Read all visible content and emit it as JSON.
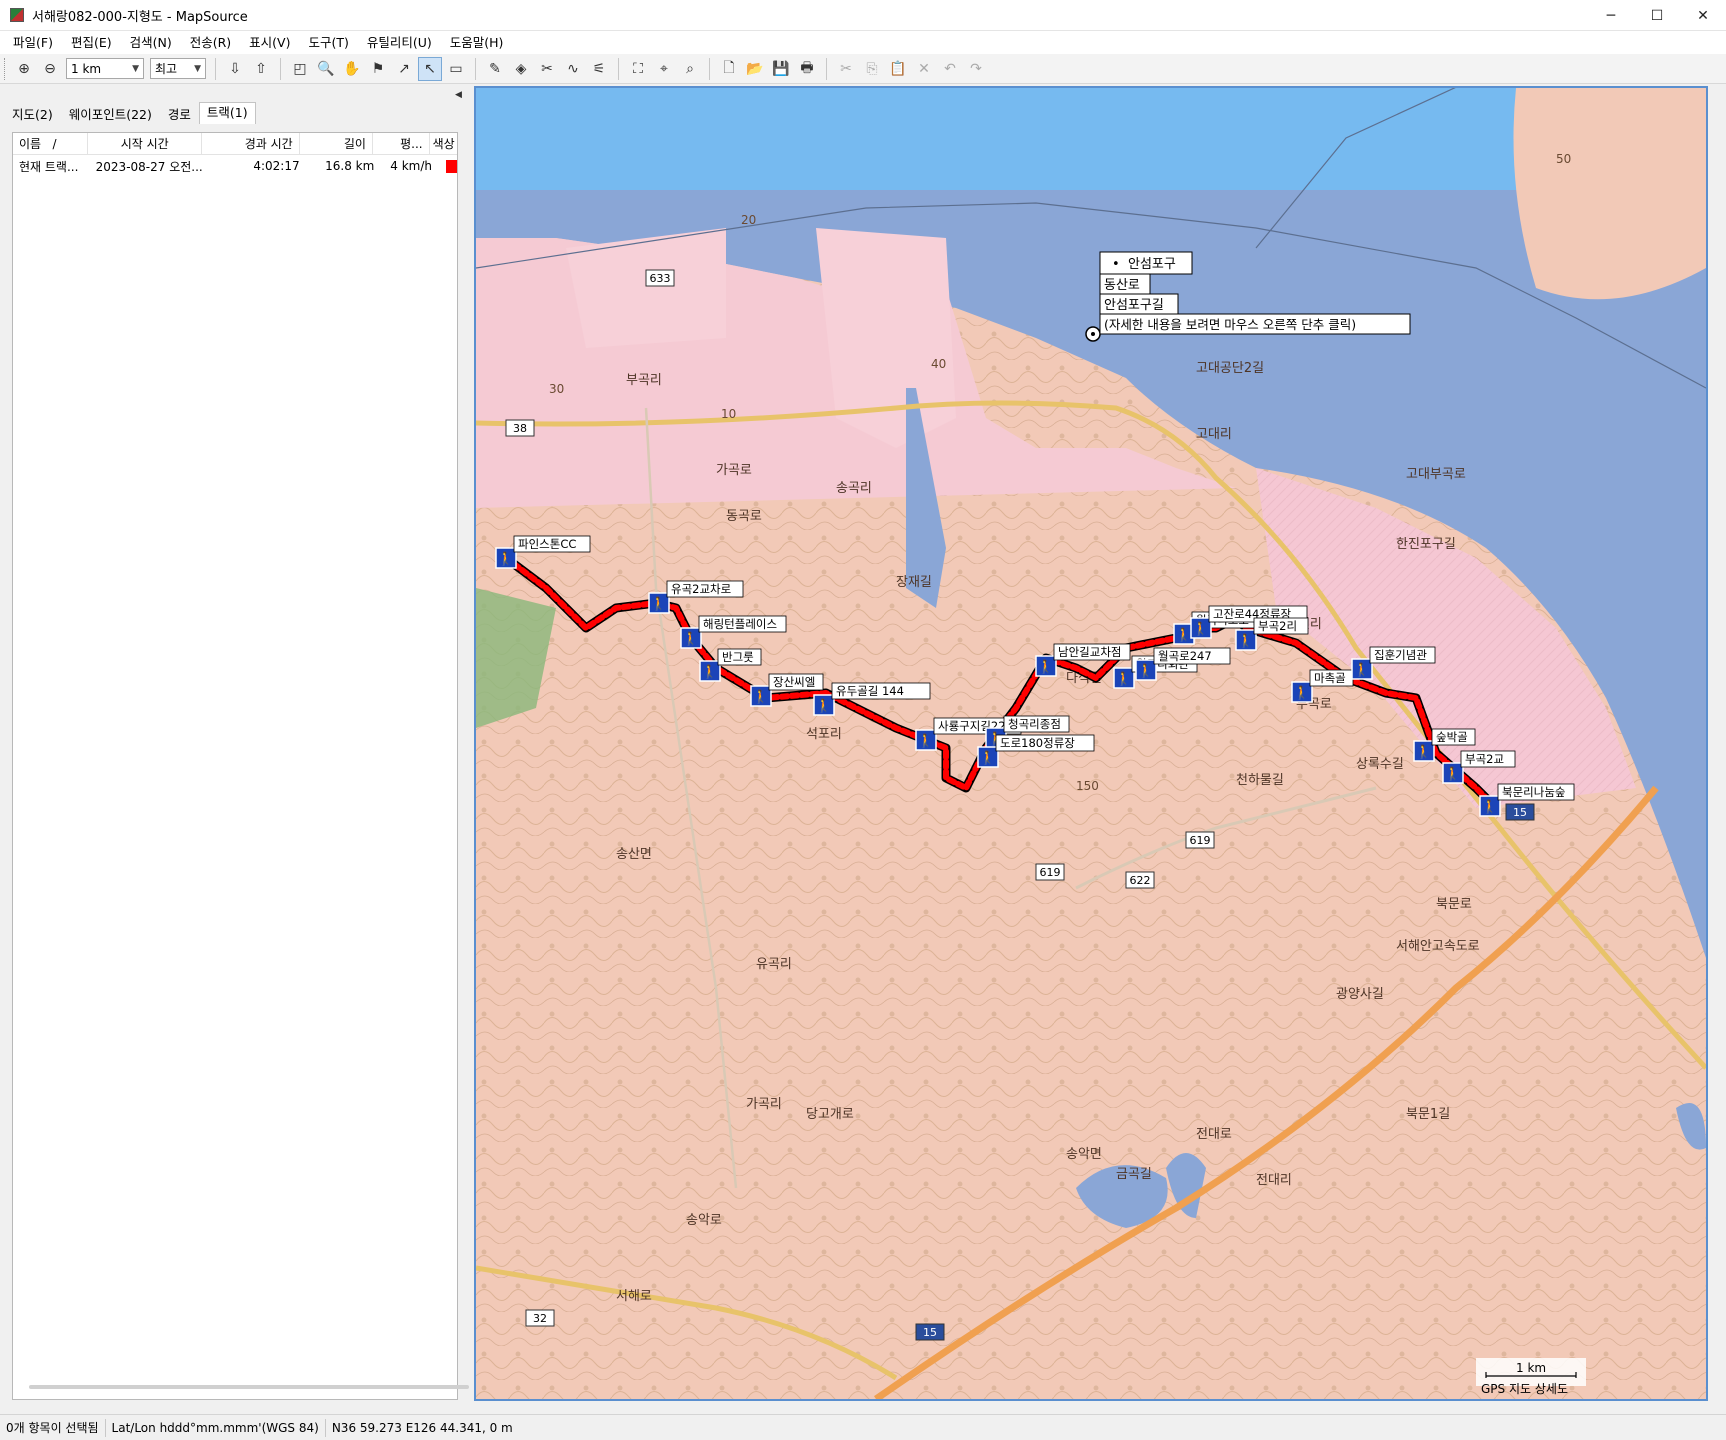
{
  "window": {
    "title": "서해랑082-000-지형도 - MapSource"
  },
  "menu": [
    "파일(F)",
    "편집(E)",
    "검색(N)",
    "전송(R)",
    "표시(V)",
    "도구(T)",
    "유틸리티(U)",
    "도움말(H)"
  ],
  "toolbar": {
    "scale_value": "1 km",
    "detail_value": "최고"
  },
  "tabs": [
    "지도(2)",
    "웨이포인트(22)",
    "경로",
    "트랙(1)"
  ],
  "track_list": {
    "headers": [
      "이름",
      "시작 시간",
      "경과 시간",
      "길이",
      "평...",
      "색상"
    ],
    "sort_marker": "/",
    "rows": [
      {
        "name": "현재 트랙...",
        "start": "2023-08-27 오전...",
        "elapsed": "4:02:17",
        "length": "16.8 km",
        "speed": "4 km/h",
        "color": "#ff0000"
      }
    ]
  },
  "map": {
    "popup": [
      "안섬포구",
      "동산로",
      "안섬포구길",
      "(자세한 내용을 보려면 마우스 오른쪽 단추 클릭)"
    ],
    "waypoints": [
      "파인스톤CC",
      "유곡2교차로",
      "해링턴플레이스",
      "반그룻",
      "장산씨엘",
      "유두골길 144",
      "사룡구지길22",
      "청곡리종점",
      "도로180정류장",
      "남안길교차점",
      "월곡리회관",
      "월곡로247",
      "월곡리보호수",
      "고잔로44정류장",
      "부곡2리",
      "마촉골",
      "집훈기념관",
      "숲박골",
      "부곡2교",
      "북문리나눔숲"
    ],
    "place_labels": [
      "가곡로",
      "동곡로",
      "장재길",
      "송산면",
      "다식길",
      "천하물길",
      "송악로",
      "당고개로",
      "송악면",
      "금곡길",
      "부곡로",
      "북문로",
      "서해로",
      "광양사길",
      "상록수길",
      "고대공단2길",
      "고대부곡로",
      "한진포구길",
      "전대로",
      "북문1길",
      "부곡리",
      "고대리",
      "송곡리",
      "가곡리",
      "유곡리",
      "전대리",
      "석포리",
      "한진리",
      "서해안고속도로"
    ],
    "route_numbers": [
      "633",
      "38",
      "619",
      "622",
      "15",
      "32"
    ],
    "contour_values": [
      "20",
      "30",
      "10",
      "40",
      "50",
      "150"
    ],
    "scale_label": "1 km",
    "map_name": "GPS 지도 상세도"
  },
  "status": {
    "selection": "0개 항목이 선택됨",
    "format": "Lat/Lon hddd°mm.mmm'(WGS 84)",
    "position": "N36 59.273 E126 44.341, 0 m"
  },
  "colors": {
    "track": "#ff0000",
    "sea": "#8aa6d6",
    "land": "#f3d0cd",
    "industrial": "#f5c7d3",
    "highway": "#f0a050",
    "road": "#e8c36a"
  }
}
